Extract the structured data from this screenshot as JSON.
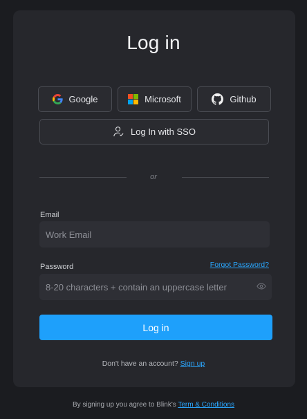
{
  "title": "Log in",
  "oauth": {
    "google": "Google",
    "microsoft": "Microsoft",
    "github": "Github",
    "sso": "Log In with SSO"
  },
  "divider": "or",
  "email": {
    "label": "Email",
    "placeholder": "Work Email"
  },
  "password": {
    "label": "Password",
    "forgot": "Forgot Password?",
    "placeholder": "8-20 characters + contain an uppercase letter"
  },
  "login_button": "Log in",
  "signup": {
    "prompt": "Don't have an account?",
    "link": "Sign up"
  },
  "footer": {
    "text": "By signing up you agree to Blink's ",
    "link": "Term & Conditions"
  },
  "colors": {
    "accent": "#1ea0fb",
    "link": "#2aa7ff",
    "background": "#1b1c20",
    "card": "#26272c"
  }
}
